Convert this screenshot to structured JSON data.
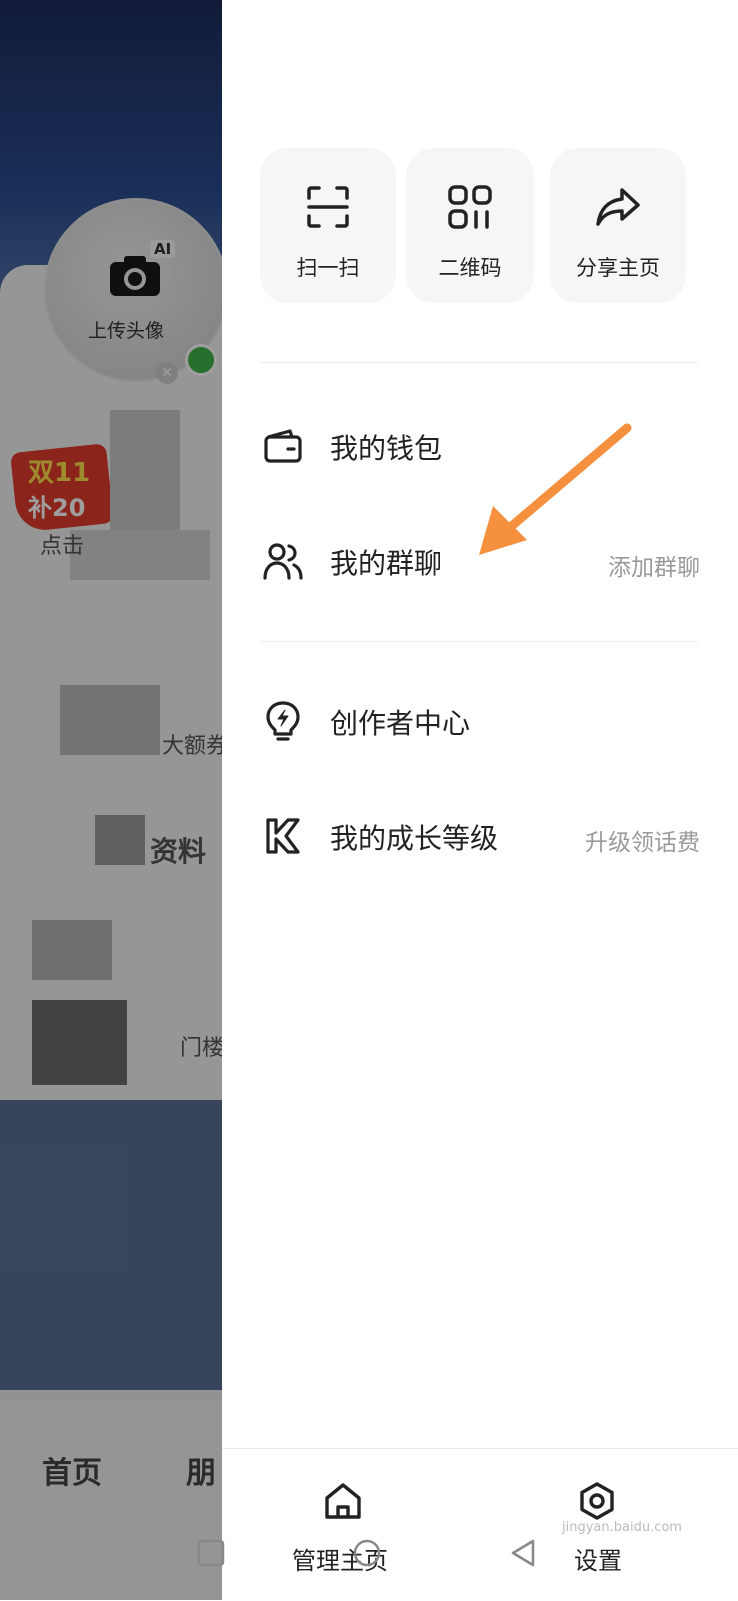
{
  "background": {
    "avatar": {
      "ai_tag": "AI",
      "upload_label": "上传头像"
    },
    "promo": {
      "line1": "双11",
      "line2": "补20"
    },
    "snippets": [
      "点击",
      "大额券",
      "资料",
      "门楼"
    ],
    "tabs": [
      "首页",
      "朋"
    ]
  },
  "quick_actions": [
    {
      "label": "扫一扫",
      "icon": "scan-icon"
    },
    {
      "label": "二维码",
      "icon": "qr-code-icon"
    },
    {
      "label": "分享主页",
      "icon": "share-icon"
    }
  ],
  "menu": [
    {
      "label": "我的钱包",
      "extra": "",
      "icon": "wallet-icon"
    },
    {
      "label": "我的群聊",
      "extra": "添加群聊",
      "icon": "group-chat-icon"
    },
    {
      "label": "创作者中心",
      "extra": "",
      "icon": "lightbulb-icon"
    },
    {
      "label": "我的成长等级",
      "extra": "升级领话费",
      "icon": "level-badge-icon"
    }
  ],
  "bottom_bar": {
    "manage_label": "管理主页",
    "settings_label": "设置"
  },
  "annotation": {
    "arrow_color": "#f5913e"
  },
  "watermark": "jingyan.baidu.com"
}
